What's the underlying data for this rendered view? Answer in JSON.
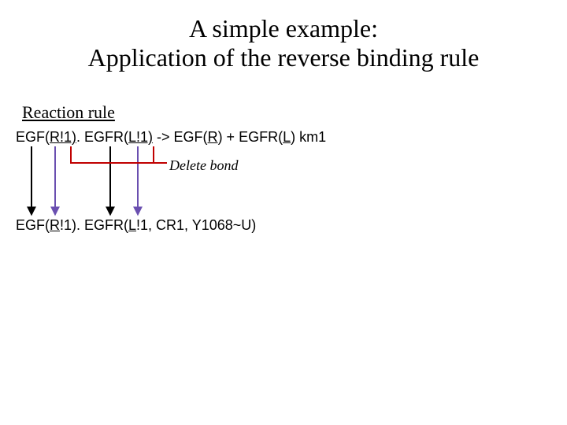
{
  "title_line1": "A simple example:",
  "title_line2": "Application of the reverse binding rule",
  "section_heading": "Reaction rule",
  "rule_parts": {
    "p1": "EGF(",
    "p2": "R!1)",
    "p3": ". EGFR(",
    "p4": "L!1)",
    "p5": " -> EGF(",
    "p6": "R",
    "p7": ") + EGFR(",
    "p8": "L",
    "p9": ") km1"
  },
  "annotation": "Delete bond",
  "target_parts": {
    "p1": "EGF(",
    "p2": "R",
    "p3": "!1). EGFR(",
    "p4": "L",
    "p5": "!1, CR1, Y1068~U)"
  },
  "arrow_colors": {
    "black": "#000000",
    "purple": "#6a4fb0",
    "red": "#c00000"
  }
}
